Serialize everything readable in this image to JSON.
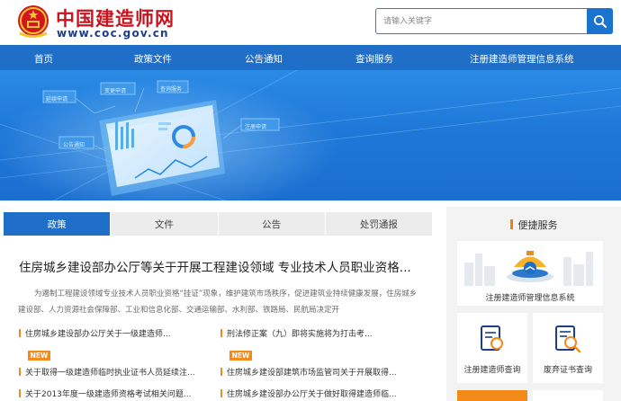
{
  "header": {
    "site_name": "中国建造师网",
    "site_url": "www.coc.gov.cn",
    "search_placeholder": "请输入关键字"
  },
  "nav": {
    "items": [
      "首页",
      "政策文件",
      "公告通知",
      "查询服务",
      "注册建造师管理信息系统"
    ]
  },
  "banner": {
    "float_labels": [
      "延续申请",
      "变更申请",
      "查询服务",
      "注册申请",
      "公告通知"
    ]
  },
  "tabs": [
    "政策",
    "文件",
    "公告",
    "处罚通报"
  ],
  "active_tab": "政策",
  "headline": "住房城乡建设部办公厅等关于开展工程建设领域 专业技术人员职业资格...",
  "summary": "为遏制工程建设领域专业技术人员职业资格“挂证”现象，维护建筑市场秩序，促进建筑业持续健康发展，住房城乡建设部、人力资源社会保障部、工业和信息化部、交通运输部、水利部、铁路局、民航局决定开",
  "new_tag": "NEW",
  "news": [
    "住房城乡建设部办公厅关于一级建造师...",
    "刑法修正案（九）即将实施将为打击考...",
    "关于取得一级建造师临时执业证书人员延续注...",
    "住房城乡建设部建筑市场监管司关于开展取得...",
    "关于2013年度一级建造师资格考试相关问题...",
    "住房城乡建设部办公厅关于做好取得建造师临..."
  ],
  "quick": {
    "title": "便捷服务",
    "cards": [
      "注册建造师管理信息系统",
      "注册建造师查询",
      "废弃证书查询"
    ]
  },
  "colors": {
    "brand_red": "#c8141e",
    "nav_blue": "#1f6ec8",
    "accent_orange": "#f28b1a"
  }
}
